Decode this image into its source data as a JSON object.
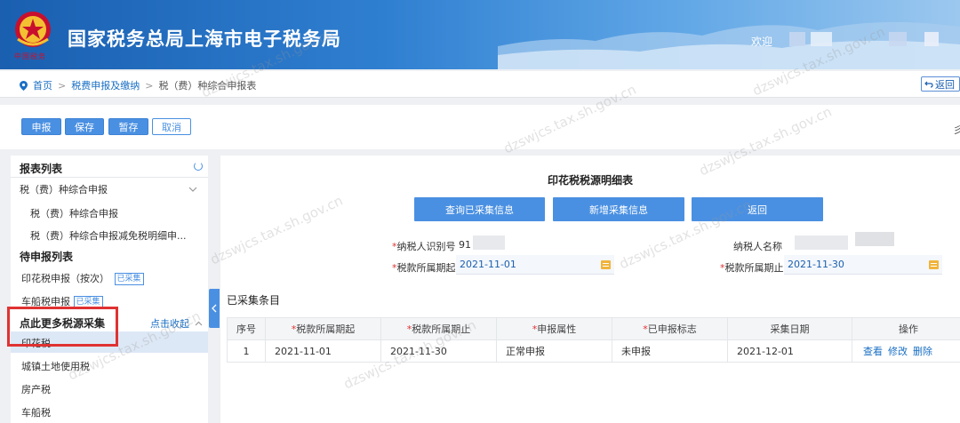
{
  "header": {
    "emblem_text": "中国税务",
    "site_title": "国家税务总局上海市电子税务局",
    "welcome_label": "欢迎",
    "colors": {
      "brand": "#2f7fd1",
      "emblem_red": "#c8102e"
    }
  },
  "breadcrumb": {
    "home": "首页",
    "level2": "税费申报及缴纳",
    "level3": "税（费）种综合申报表",
    "back_label": "返回"
  },
  "toolbar": {
    "declare": "申报",
    "save": "保存",
    "temp_save": "暂存",
    "cancel": "取消",
    "right_text": "彡"
  },
  "sidebar": {
    "report_list_title": "报表列表",
    "report_group": "税（费）种综合申报",
    "report_items": [
      "税（费）种综合申报",
      "税（费）种综合申报减免税明细申..."
    ],
    "pending_title": "待申报列表",
    "pending_items": [
      {
        "label": "印花税申报（按次）",
        "tag": "已采集"
      },
      {
        "label": "车船税申报",
        "tag": "已采集"
      }
    ],
    "more_title": "点此更多税源采集",
    "collapse_label": "点击收起",
    "more_items": [
      "印花税",
      "城镇土地使用税",
      "房产税",
      "车船税"
    ],
    "selected_index": 0
  },
  "main": {
    "title": "印花税税源明细表",
    "buttons": {
      "query": "查询已采集信息",
      "add": "新增采集信息",
      "back": "返回"
    },
    "form": {
      "taxpayer_id_label": "纳税人识别号",
      "taxpayer_id_value": "91",
      "taxpayer_name_label": "纳税人名称",
      "period_start_label": "税款所属期起",
      "period_start_value": "2021-11-01",
      "period_end_label": "税款所属期止",
      "period_end_value": "2021-11-30"
    },
    "collected_heading": "已采集条目",
    "table": {
      "headers": [
        "序号",
        "税款所属期起",
        "税款所属期止",
        "申报属性",
        "已申报标志",
        "采集日期",
        "操作"
      ],
      "rows": [
        {
          "no": "1",
          "start": "2021-11-01",
          "end": "2021-11-30",
          "attr": "正常申报",
          "flag": "未申报",
          "date": "2021-12-01"
        }
      ],
      "ops": [
        "查看",
        "修改",
        "删除"
      ]
    }
  },
  "watermark": "dzswjcs.tax.sh.gov.cn"
}
